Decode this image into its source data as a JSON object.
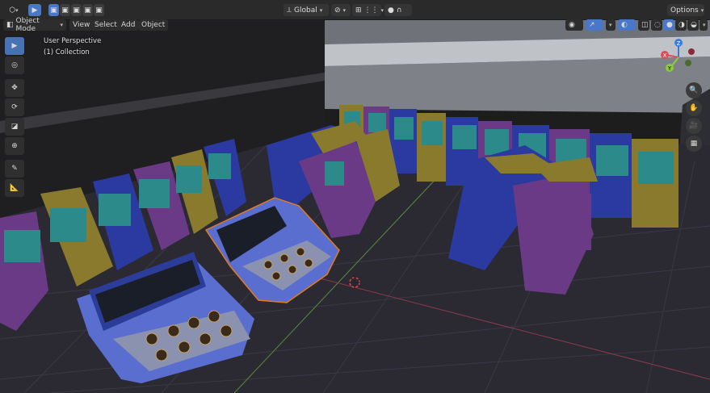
{
  "header": {
    "orientation": {
      "label": "Global"
    },
    "options_label": "Options"
  },
  "menu": {
    "mode": "Object Mode",
    "items": [
      "View",
      "Select",
      "Add",
      "Object"
    ]
  },
  "viewport": {
    "perspective": "User Perspective",
    "collection": "(1) Collection"
  },
  "gizmo": {
    "z": "Z",
    "x": "X",
    "y": "Y"
  },
  "colors": {
    "accent": "#4772b3",
    "header_bg": "#2a2a2a",
    "x_axis": "#e04a5a",
    "y_axis": "#8ccc3a",
    "z_axis": "#3a7ae0",
    "selection_outline": "#e07a20"
  },
  "icons": {
    "editor_type": "viewport-editor-icon",
    "select_mode": "select-box-icon",
    "cursor_tool": "cursor-icon",
    "move_tool": "move-icon",
    "rotate_tool": "rotate-icon",
    "scale_tool": "scale-icon",
    "transform_tool": "transform-icon",
    "annotate_tool": "annotate-icon",
    "measure_tool": "measure-icon",
    "zoom": "zoom-icon",
    "pan": "hand-icon",
    "camera": "camera-icon",
    "perspective_toggle": "grid-icon"
  }
}
